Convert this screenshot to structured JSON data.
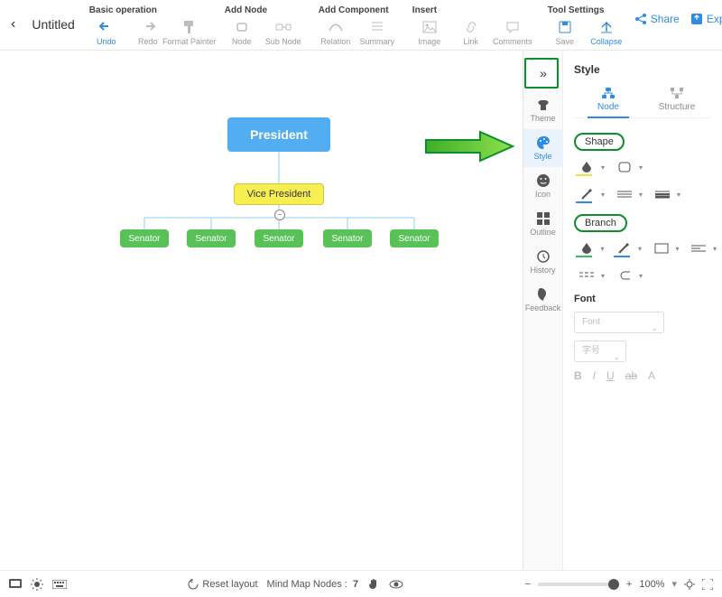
{
  "header": {
    "title": "Untitled",
    "groups": [
      {
        "label": "Basic operation",
        "buttons": [
          {
            "id": "undo",
            "label": "Undo",
            "active": true
          },
          {
            "id": "redo",
            "label": "Redo"
          },
          {
            "id": "format-painter",
            "label": "Format Painter"
          }
        ]
      },
      {
        "label": "Add Node",
        "buttons": [
          {
            "id": "node",
            "label": "Node"
          },
          {
            "id": "sub-node",
            "label": "Sub Node"
          }
        ]
      },
      {
        "label": "Add Component",
        "buttons": [
          {
            "id": "relation",
            "label": "Relation"
          },
          {
            "id": "summary",
            "label": "Summary"
          }
        ]
      },
      {
        "label": "Insert",
        "buttons": [
          {
            "id": "image",
            "label": "Image"
          },
          {
            "id": "link",
            "label": "Link"
          },
          {
            "id": "comments",
            "label": "Comments"
          }
        ]
      },
      {
        "label": "Tool Settings",
        "buttons": [
          {
            "id": "save",
            "label": "Save"
          },
          {
            "id": "collapse",
            "label": "Collapse",
            "active": true
          }
        ]
      }
    ],
    "share": "Share",
    "export": "Export"
  },
  "nodes": {
    "president": "President",
    "vice": "Vice President",
    "senators": [
      "Senator",
      "Senator",
      "Senator",
      "Senator",
      "Senator"
    ]
  },
  "side": {
    "title": "Style",
    "tabs": [
      "Theme",
      "Style",
      "Icon",
      "Outline",
      "History",
      "Feedback"
    ],
    "panel_tabs": {
      "node": "Node",
      "structure": "Structure"
    },
    "sections": {
      "shape": "Shape",
      "branch": "Branch",
      "font": "Font"
    },
    "font_placeholder": "Font",
    "size_placeholder": "字号"
  },
  "bottom": {
    "reset": "Reset layout",
    "nodes_label": "Mind Map Nodes :",
    "nodes_count": "7",
    "zoom": "100%"
  }
}
